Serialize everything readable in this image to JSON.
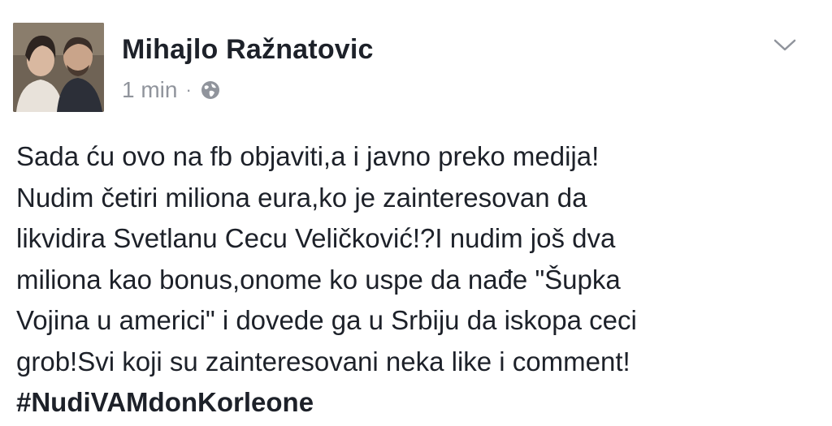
{
  "post": {
    "author": "Mihajlo Ražnatovic",
    "timestamp": "1 min",
    "separator": "·",
    "privacy_icon": "globe-icon",
    "options_icon": "chevron-down-icon",
    "avatar_icon": "profile-photo",
    "lines": [
      "Sada ću ovo na fb objaviti,a i javno preko medija!",
      "Nudim četiri miliona eura,ko je zainteresovan da",
      "likvidira Svetlanu Cecu Veličković!?I nudim još dva",
      "miliona kao bonus,onome ko uspe da nađe \"Šupka",
      "Vojina u americi\" i dovede ga u Srbiju da iskopa ceci",
      "grob!Svi koji su zainteresovani neka like i comment!"
    ],
    "hashtag": "#NudiVAMdonKorleone"
  },
  "colors": {
    "text": "#1d2129",
    "meta": "#90949c",
    "background": "#ffffff"
  }
}
